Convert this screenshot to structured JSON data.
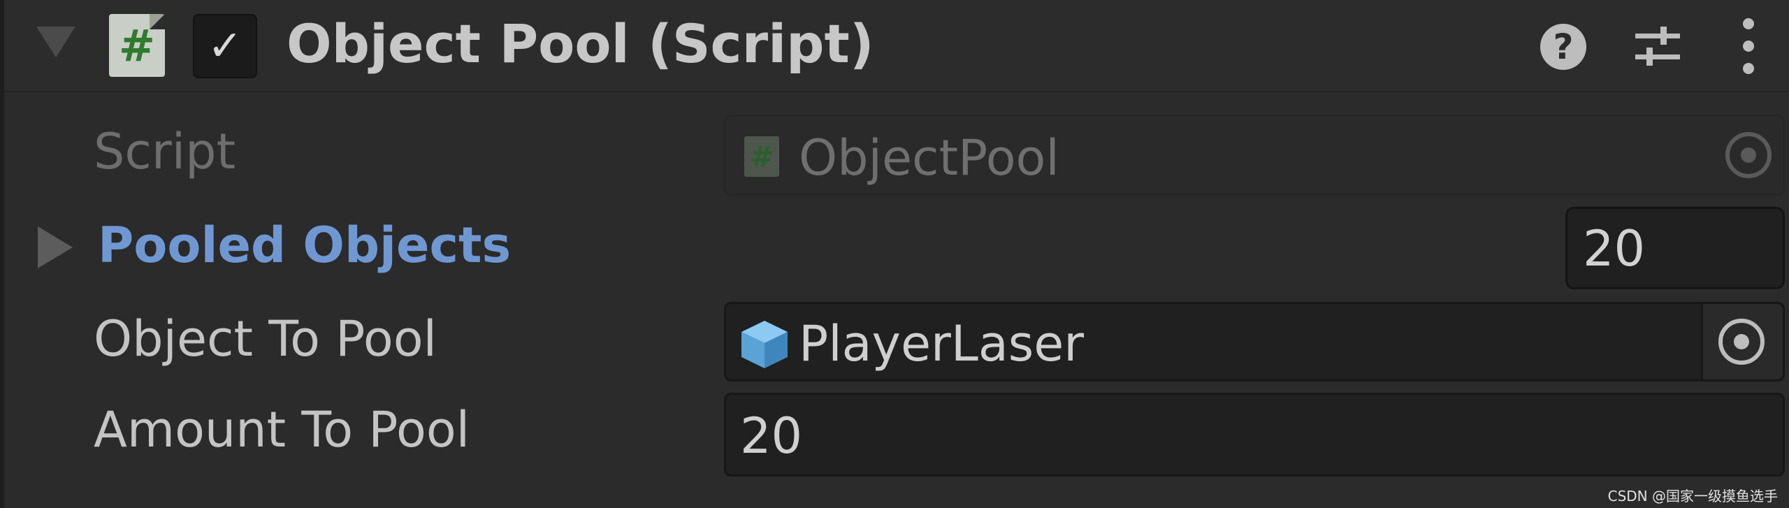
{
  "component": {
    "title": "Object Pool (Script)",
    "script_icon_glyph": "#",
    "enabled_glyph": "✓",
    "help_icon_glyph": "?",
    "icons": [
      "foldout-arrow-icon",
      "script-icon",
      "checkbox-icon",
      "help-icon",
      "presets-icon",
      "kebab-menu-icon"
    ]
  },
  "rows": {
    "script": {
      "label": "Script",
      "value": "ObjectPool",
      "icon": "script-icon",
      "mini_icon_glyph": "#"
    },
    "pooled_objects": {
      "label": "Pooled Objects",
      "count": "20"
    },
    "object_to_pool": {
      "label": "Object To Pool",
      "value": "PlayerLaser",
      "icon": "prefab-cube-icon"
    },
    "amount_to_pool": {
      "label": "Amount To Pool",
      "value": "20"
    }
  },
  "watermark": "CSDN @国家一级摸鱼选手",
  "colors": {
    "background": "#2b2b2b",
    "title_text": "#c7c7c7",
    "label_text": "#c4c4c4",
    "list_label_blue": "#6f97d2",
    "field_background": "#202020",
    "script_hash_green": "#2f7a2f",
    "prefab_cube_blue": "#6ab0e0"
  }
}
